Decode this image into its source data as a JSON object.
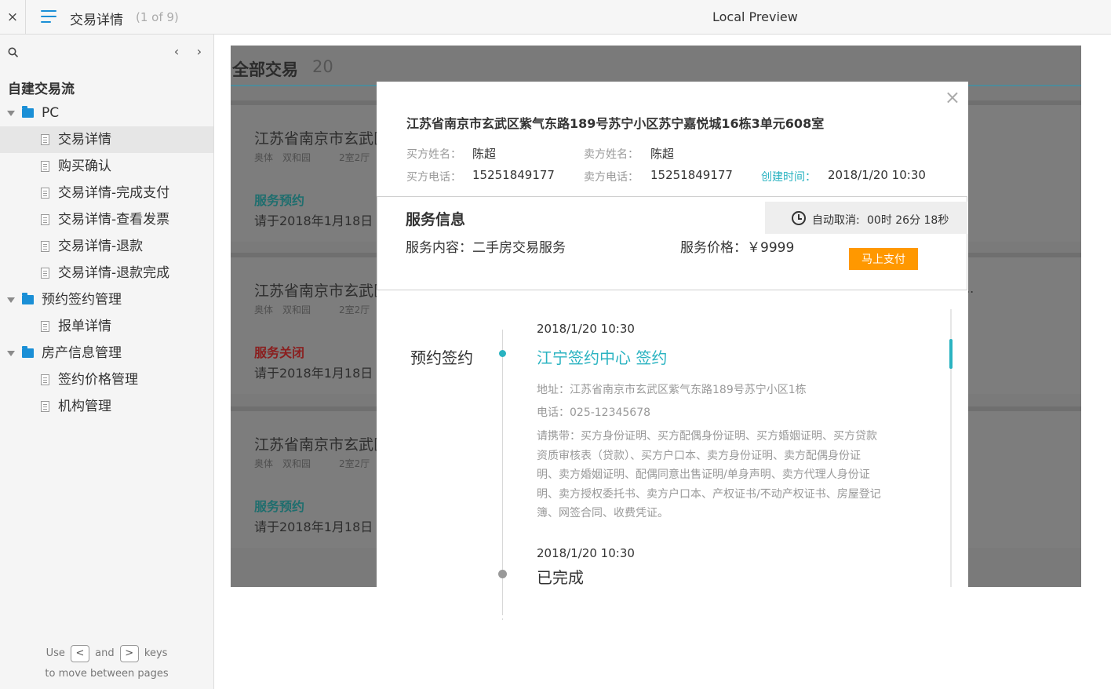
{
  "topbar": {
    "close_glyph": "×",
    "menu_icon": "menu-icon",
    "page_title": "交易详情",
    "page_count": "(1 of 9)",
    "preview_label": "Local Preview"
  },
  "sidebar": {
    "search_icon": "search-icon",
    "prev_glyph": "‹",
    "next_glyph": "›",
    "project_title": "自建交易流",
    "folders": {
      "pc": "PC",
      "appointment": "预约签约管理",
      "property": "房产信息管理"
    },
    "pages": {
      "p1": "交易详情",
      "p2": "购买确认",
      "p3": "交易详情-完成支付",
      "p4": "交易详情-查看发票",
      "p5": "交易详情-退款",
      "p6": "交易详情-退款完成",
      "p7": "报单详情",
      "p8": "签约价格管理",
      "p9": "机构管理"
    },
    "active_page": "交易详情",
    "hint": {
      "use": "Use",
      "key_prev": "<",
      "and": "and",
      "key_next": ">",
      "keys": "keys",
      "line2": "to move between pages"
    }
  },
  "background": {
    "title": "全部交易",
    "count": "20",
    "cards": [
      {
        "address": "江苏省南京市玄武区",
        "district": "奥体",
        "community": "双和园",
        "layout": "2室2厅",
        "status": "服务预约",
        "status_color": "#1f6e6e",
        "date": "请于2018年1月18日"
      },
      {
        "address": "江苏省南京市玄武区",
        "district": "奥体",
        "community": "双和园",
        "layout": "2室2厅",
        "status": "服务关闭",
        "status_color": "#8a1f1f",
        "date": "请于2018年1月18日"
      },
      {
        "address": "江苏省南京市玄武区",
        "district": "奥体",
        "community": "双和园",
        "layout": "2室2厅",
        "status": "服务预约",
        "status_color": "#1f6e6e",
        "date": "请于2018年1月18日"
      }
    ],
    "ellipsis": "..."
  },
  "modal": {
    "close_glyph": "×",
    "address": "江苏省南京市玄武区紫气东路189号苏宁小区苏宁嘉悦城16栋3单元608室",
    "buyer_name_label": "买方姓名：",
    "buyer_name": "陈超",
    "seller_name_label": "卖方姓名：",
    "seller_name": "陈超",
    "buyer_phone_label": "买方电话：",
    "buyer_phone": "15251849177",
    "seller_phone_label": "卖方电话：",
    "seller_phone": "15251849177",
    "created_label": "创建时间：",
    "created_time": "2018/1/20  10:30",
    "service": {
      "title": "服务信息",
      "content": "服务内容：二手房交易服务",
      "price": "服务价格：￥9999",
      "countdown_label": "自动取消:",
      "countdown_value": "00时 26分 18秒",
      "pay_button": "马上支付"
    },
    "timeline": {
      "step_label": "预约签约",
      "item1_date": "2018/1/20  10:30",
      "item1_place": "江宁签约中心 签约",
      "item1_address": "地址：江苏省南京市玄武区紫气东路189号苏宁小区1栋",
      "item1_phone": "电话：025-12345678",
      "item1_bring": "请携带：买方身份证明、买方配偶身份证明、买方婚姻证明、买方贷款资质审核表（贷款）、买方户口本、卖方身份证明、卖方配偶身份证明、卖方婚姻证明、配偶同意出售证明/单身声明、卖方代理人身份证明、卖方授权委托书、卖方户口本、产权证书/不动产权证书、房屋登记簿、网签合同、收费凭证。",
      "item2_date": "2018/1/20  10:30",
      "item2_status": "已完成"
    }
  },
  "colors": {
    "accent_blue": "#1a8fd6",
    "teal": "#2ab3c1",
    "orange": "#ff9800"
  }
}
